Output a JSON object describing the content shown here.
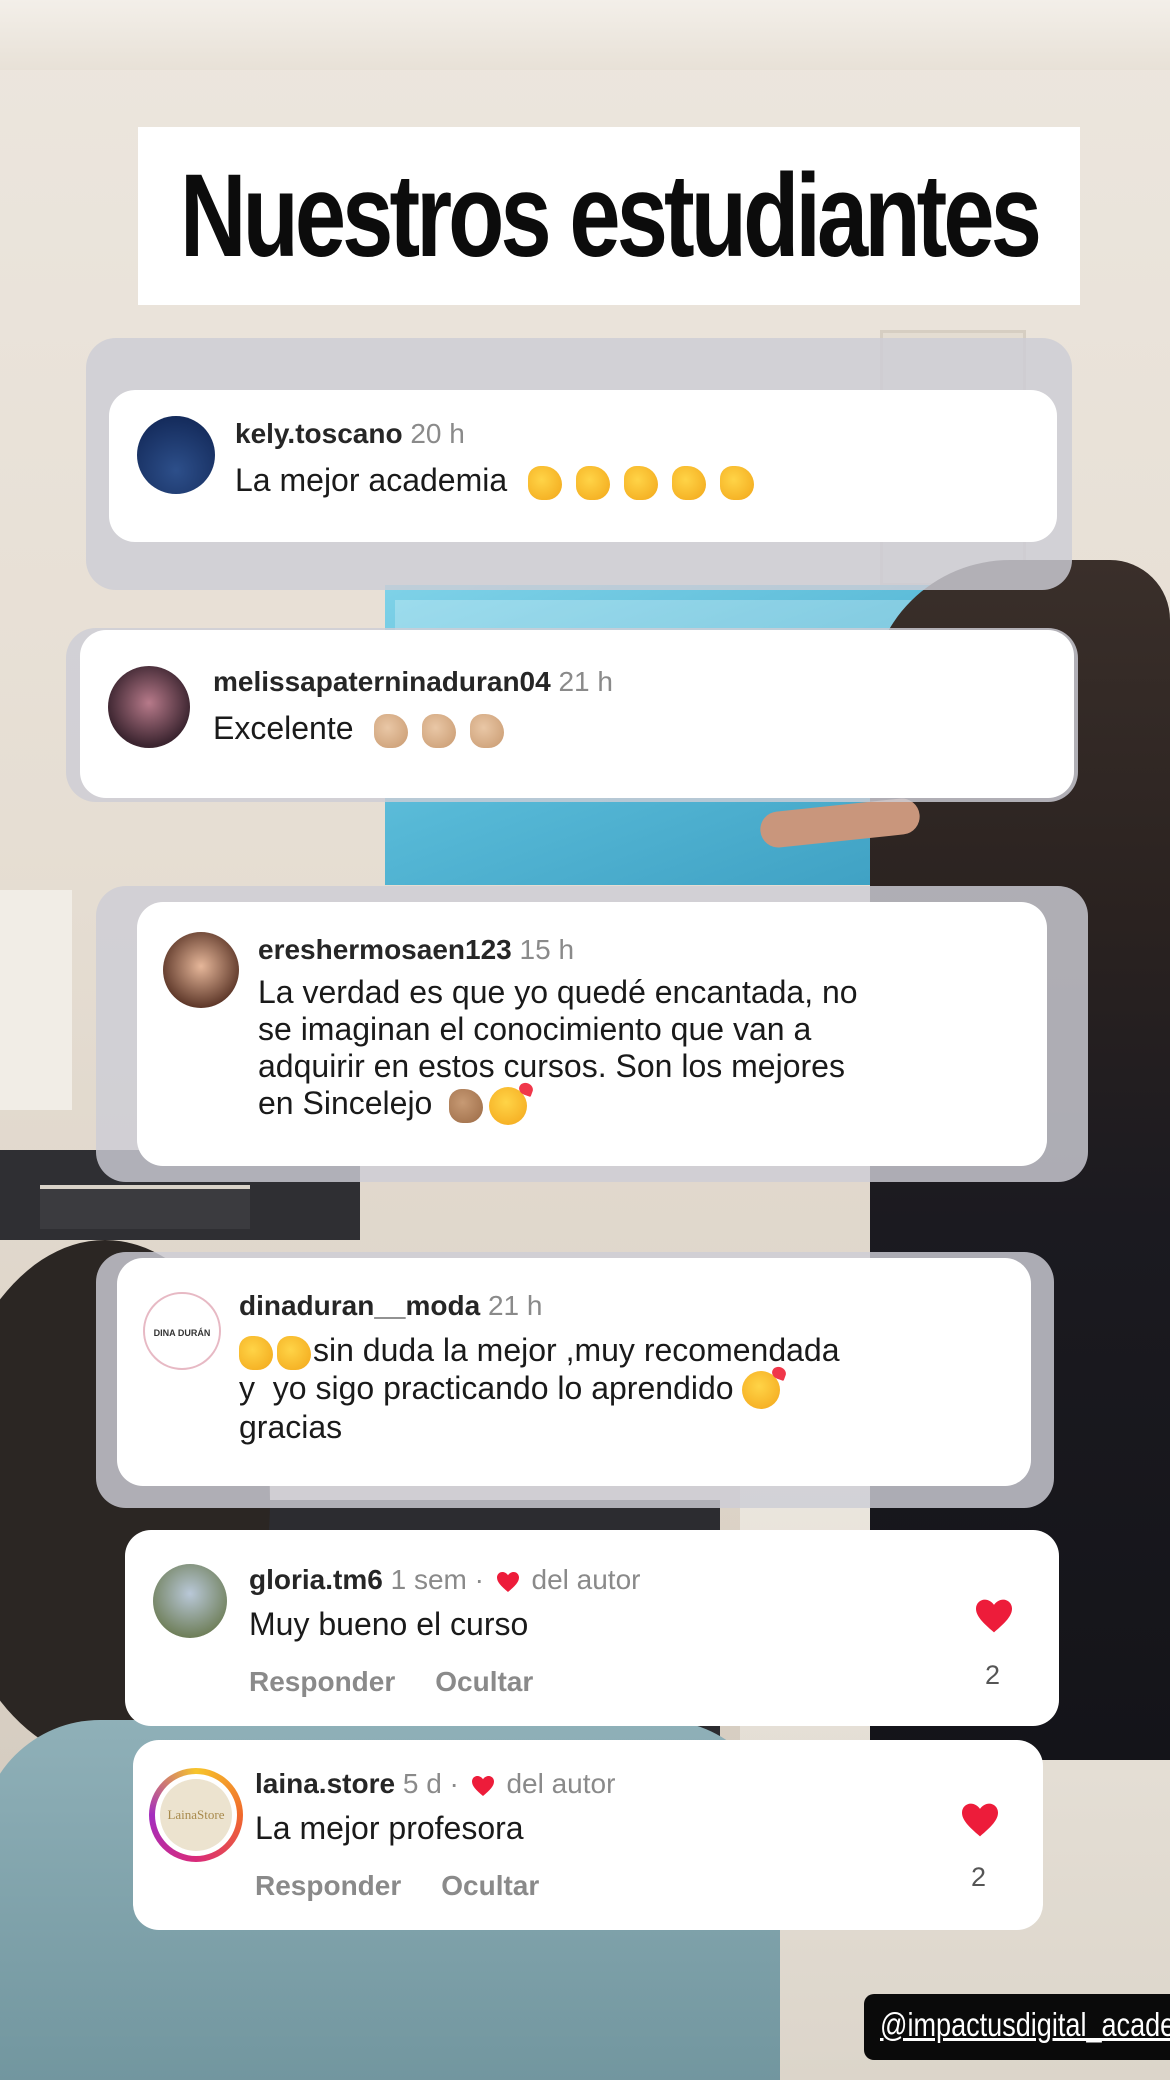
{
  "title": "Nuestros estudiantes",
  "comments": [
    {
      "username": "kely.toscano",
      "time": "20 h",
      "text": "La mejor academia",
      "emoji": "clapping-hands x5"
    },
    {
      "username": "melissapaterninaduran04",
      "time": "21 h",
      "text": "Excelente",
      "emoji": "clapping-hands-light x3"
    },
    {
      "username": "ereshermosaen123",
      "time": "15 h",
      "lines": [
        "La verdad es que yo quedé encantada, no",
        "se imaginan el conocimiento que van a",
        "adquirir en estos cursos. Son los mejores",
        "en Sincelejo"
      ],
      "emoji": "clapping-hands-medium, smiling-face-with-hearts"
    },
    {
      "username": "dinaduran__moda",
      "time": "21 h",
      "lines": [
        "sin duda la mejor ,muy recomendada",
        "y  yo sigo practicando lo aprendido",
        "gracias"
      ],
      "avatar_text": "DINA DURÁN",
      "emoji": "clapping-hands x2, smiling-face-with-hearts"
    },
    {
      "username": "gloria.tm6",
      "time": "1 sem ·",
      "author_badge": "del autor",
      "text": "Muy bueno el curso",
      "reply": "Responder",
      "hide": "Ocultar",
      "likes": "2"
    },
    {
      "username": "laina.store",
      "time": "5 d ·",
      "author_badge": "del autor",
      "text": "La mejor profesora",
      "reply": "Responder",
      "hide": "Ocultar",
      "likes": "2",
      "avatar_text": "LainaStore"
    }
  ],
  "watermark": "@impactusdigital_acade",
  "colors": {
    "heart": "#ed1c3a",
    "card": "#ffffff",
    "title_bg": "#ffffff"
  }
}
